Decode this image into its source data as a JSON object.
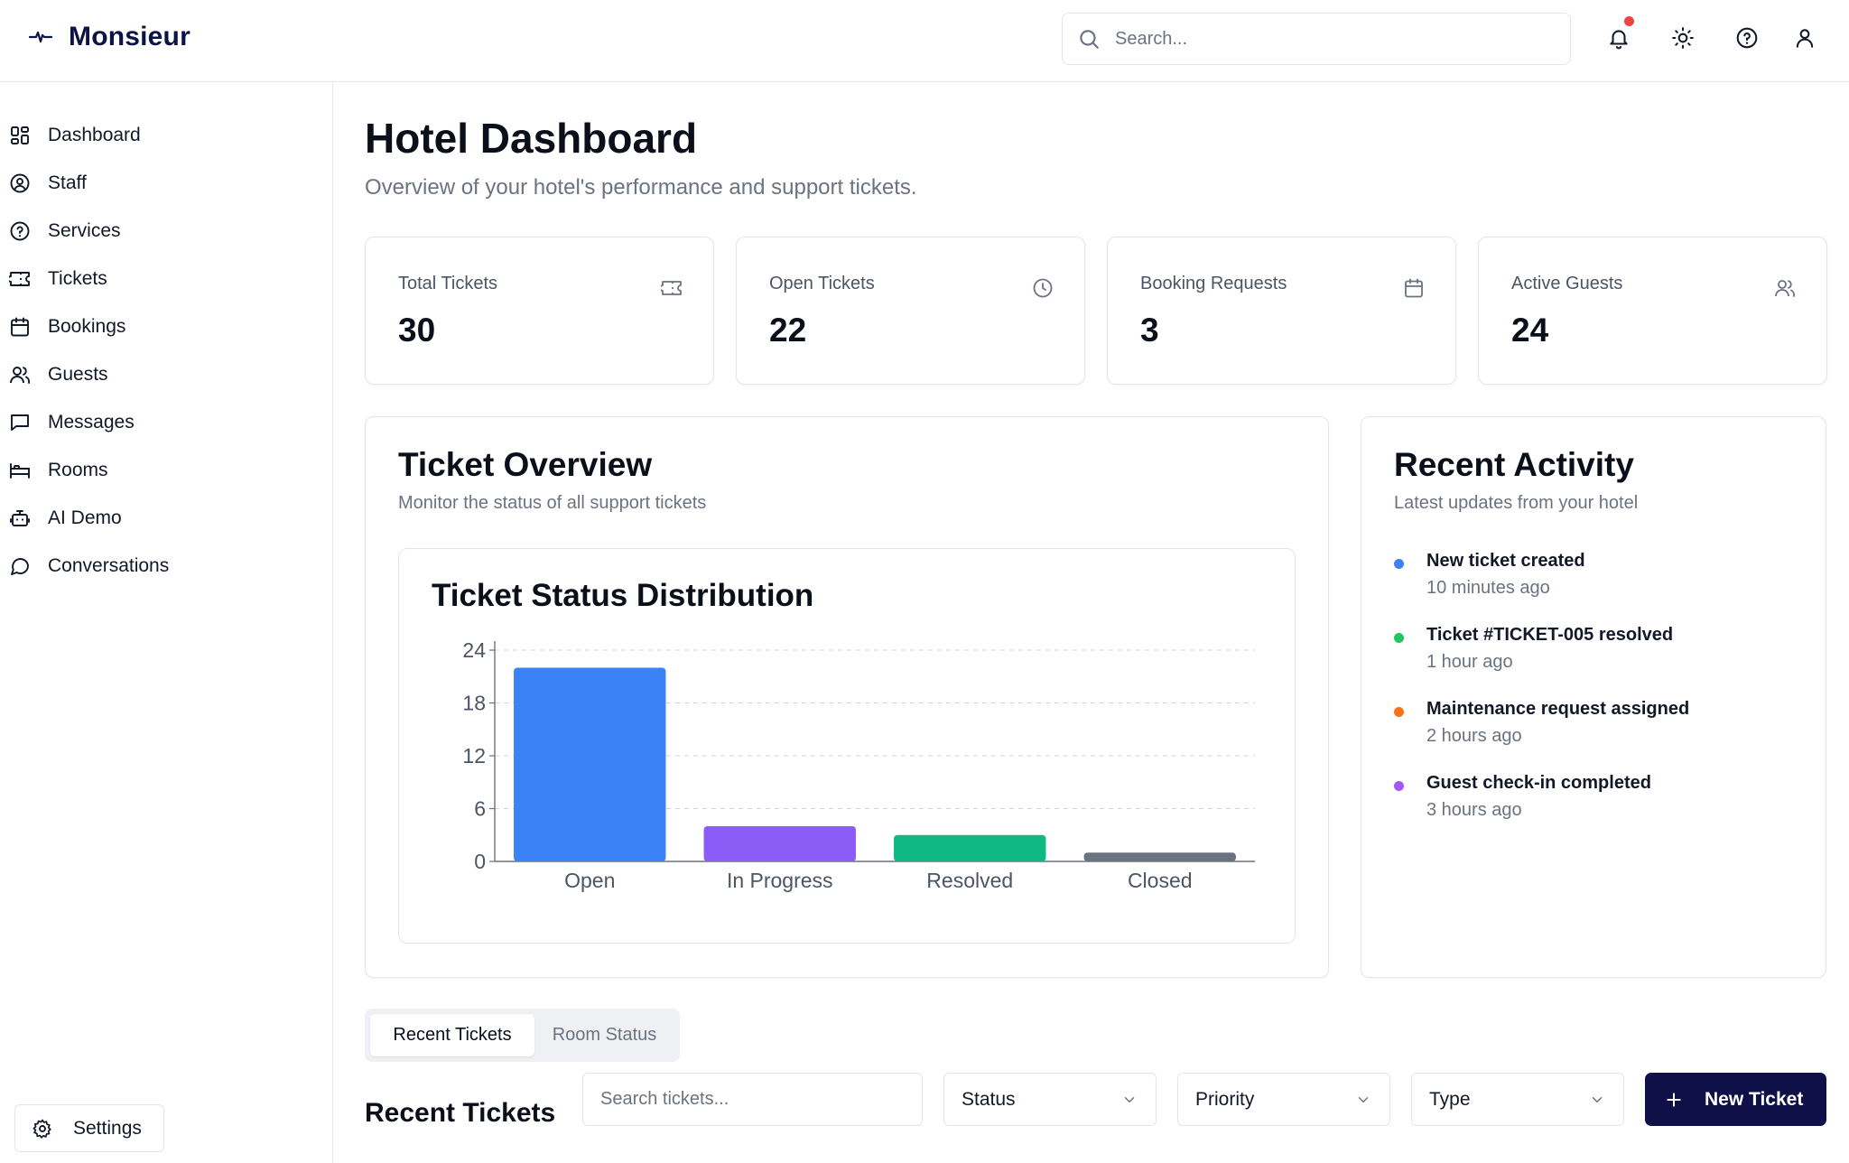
{
  "app": {
    "name": "Monsieur"
  },
  "header": {
    "search_placeholder": "Search...",
    "icons": [
      "bell-icon",
      "sun-icon",
      "help-icon",
      "user-icon"
    ]
  },
  "sidebar": {
    "items": [
      {
        "label": "Dashboard",
        "icon": "dashboard-icon"
      },
      {
        "label": "Staff",
        "icon": "user-circle-icon"
      },
      {
        "label": "Services",
        "icon": "help-circle-icon"
      },
      {
        "label": "Tickets",
        "icon": "ticket-icon"
      },
      {
        "label": "Bookings",
        "icon": "calendar-icon"
      },
      {
        "label": "Guests",
        "icon": "users-icon"
      },
      {
        "label": "Messages",
        "icon": "message-square-icon"
      },
      {
        "label": "Rooms",
        "icon": "bed-icon"
      },
      {
        "label": "AI Demo",
        "icon": "bot-icon"
      },
      {
        "label": "Conversations",
        "icon": "message-circle-icon"
      }
    ],
    "settings_label": "Settings"
  },
  "page": {
    "title": "Hotel Dashboard",
    "subtitle": "Overview of your hotel's performance and support tickets."
  },
  "stats": [
    {
      "label": "Total Tickets",
      "value": "30",
      "icon": "ticket-icon"
    },
    {
      "label": "Open Tickets",
      "value": "22",
      "icon": "clock-icon"
    },
    {
      "label": "Booking Requests",
      "value": "3",
      "icon": "calendar-icon"
    },
    {
      "label": "Active Guests",
      "value": "24",
      "icon": "users-icon"
    }
  ],
  "ticket_overview": {
    "title": "Ticket Overview",
    "subtitle": "Monitor the status of all support tickets"
  },
  "chart_data": {
    "type": "bar",
    "title": "Ticket Status Distribution",
    "categories": [
      "Open",
      "In Progress",
      "Resolved",
      "Closed"
    ],
    "values": [
      22,
      4,
      3,
      1
    ],
    "colors": [
      "#3b82f6",
      "#8b5cf6",
      "#10b981",
      "#6b7280"
    ],
    "yticks": [
      "0",
      "6",
      "12",
      "18",
      "24"
    ],
    "ylim": [
      0,
      24
    ],
    "grid": true,
    "xlabel": "",
    "ylabel": ""
  },
  "activity": {
    "title": "Recent Activity",
    "subtitle": "Latest updates from your hotel",
    "items": [
      {
        "title": "New ticket created",
        "time": "10 minutes ago",
        "color": "#3b82f6"
      },
      {
        "title": "Ticket #TICKET-005 resolved",
        "time": "1 hour ago",
        "color": "#22c55e"
      },
      {
        "title": "Maintenance request assigned",
        "time": "2 hours ago",
        "color": "#f97316"
      },
      {
        "title": "Guest check-in completed",
        "time": "3 hours ago",
        "color": "#a855f7"
      }
    ]
  },
  "tabs": {
    "active": "Recent Tickets",
    "inactive": "Room Status"
  },
  "recent_tickets": {
    "title": "Recent Tickets",
    "search_placeholder": "Search tickets...",
    "filters": [
      "Status",
      "Priority",
      "Type"
    ],
    "new_button": "New Ticket"
  }
}
